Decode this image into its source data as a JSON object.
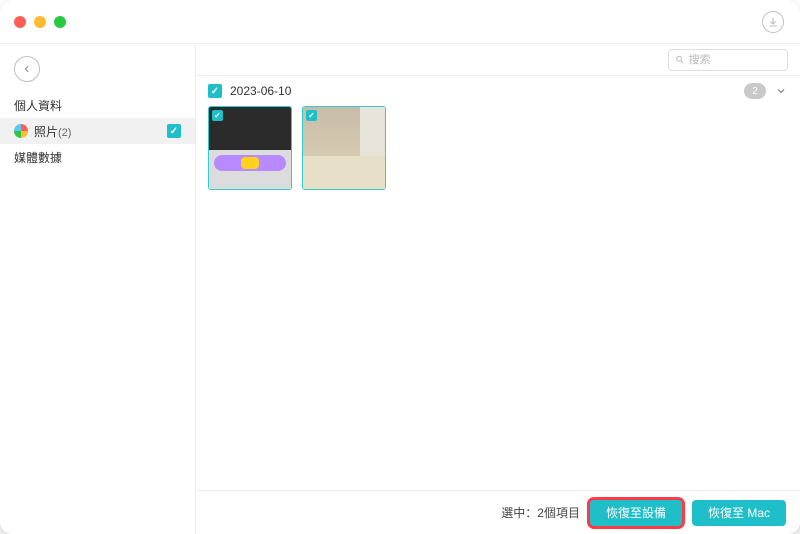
{
  "sidebar": {
    "items": [
      {
        "label": "個人資料"
      },
      {
        "label": "照片",
        "count": "(2)",
        "active": true,
        "checked": true
      },
      {
        "label": "媒體數據"
      }
    ]
  },
  "search": {
    "placeholder": "搜索"
  },
  "group": {
    "date": "2023-06-10",
    "count": "2"
  },
  "thumbs": [
    {
      "name": "photo-1"
    },
    {
      "name": "photo-2"
    }
  ],
  "footer": {
    "selection": "選中：2個項目",
    "restore_device": "恢復至設備",
    "restore_mac": "恢復至 Mac"
  }
}
